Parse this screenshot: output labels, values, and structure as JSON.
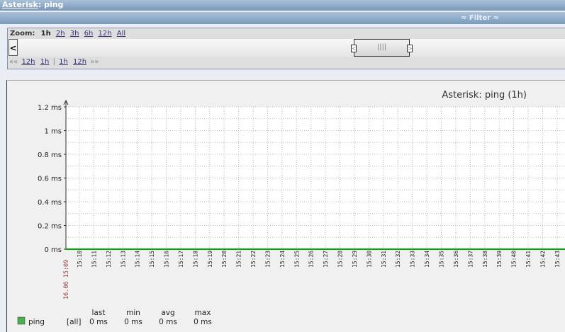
{
  "header": {
    "host_link": "Asterisk",
    "title_rest": ": ping"
  },
  "filter": {
    "label": "≈ Filter ≈"
  },
  "zoom": {
    "label": "Zoom:",
    "options": [
      "1h",
      "2h",
      "3h",
      "6h",
      "12h",
      "All"
    ],
    "selected": "1h"
  },
  "nav": {
    "back": "««",
    "links_back": [
      "12h",
      "1h"
    ],
    "sep": "|",
    "links_fwd": [
      "1h",
      "12h"
    ],
    "fwd": "»»"
  },
  "scroll": {
    "left_btn": "<",
    "handle_left": "<",
    "handle_right": ">",
    "grip": "||||"
  },
  "chart_data": {
    "type": "line",
    "title": "Asterisk: ping (1h)",
    "ylabel": "",
    "xlabel": "",
    "ylim": [
      0,
      1.2
    ],
    "y_ticks": [
      "0 ms",
      "0.2 ms",
      "0.4 ms",
      "0.6 ms",
      "0.8 ms",
      "1 ms",
      "1.2 ms"
    ],
    "x_start_label": "16.06 15:09",
    "x_ticks": [
      "15:10",
      "15:11",
      "15:12",
      "15:13",
      "15:14",
      "15:15",
      "15:16",
      "15:17",
      "15:18",
      "15:19",
      "15:20",
      "15:21",
      "15:22",
      "15:23",
      "15:24",
      "15:25",
      "15:26",
      "15:27",
      "15:28",
      "15:29",
      "15:30",
      "15:31",
      "15:32",
      "15:33",
      "15:34",
      "15:35",
      "15:36",
      "15:37",
      "15:38",
      "15:39",
      "15:40",
      "15:41",
      "15:42",
      "15:43"
    ],
    "series": [
      {
        "name": "ping",
        "color": "#00aa00",
        "values_ms": [
          0
        ]
      }
    ],
    "legend": {
      "headers": [
        "last",
        "min",
        "avg",
        "max"
      ],
      "item": {
        "name": "ping",
        "scope": "[all]",
        "last": "0 ms",
        "min": "0 ms",
        "avg": "0 ms",
        "max": "0 ms",
        "color": "#4caf50"
      }
    }
  }
}
